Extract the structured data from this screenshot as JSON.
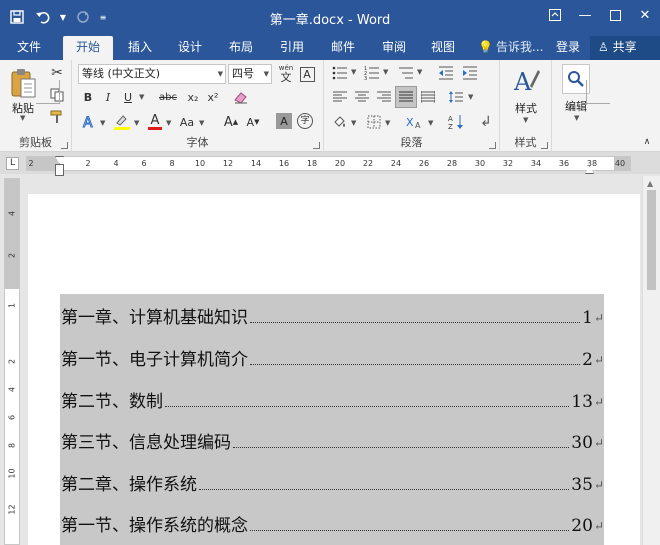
{
  "app": {
    "document_title": "第一章.docx - Word",
    "colors": {
      "brand": "#2b579a",
      "selection": "#c8c8c8"
    }
  },
  "tabs": [
    "文件",
    "开始",
    "插入",
    "设计",
    "布局",
    "引用",
    "邮件",
    "审阅",
    "视图"
  ],
  "active_tab": "开始",
  "tell_me": "告诉我...",
  "sign_in": "登录",
  "share": "共享",
  "ribbon": {
    "clipboard": {
      "label": "剪贴板",
      "paste": "粘贴"
    },
    "font": {
      "label": "字体",
      "font_name": "等线 (中文正文)",
      "font_size": "四号",
      "wen": "wén",
      "wen_char": "文",
      "A_big": "A",
      "bold": "B",
      "italic": "I",
      "underline": "U",
      "strike": "abc",
      "subscript": "x₂",
      "superscript": "x²",
      "aa_up": "A",
      "aa_down": "A",
      "char_shade": "A",
      "enclose": "字"
    },
    "paragraph": {
      "label": "段落"
    },
    "styles": {
      "label": "样式",
      "button": "样式"
    },
    "editing": {
      "button": "编辑"
    }
  },
  "ruler": {
    "numbers": [
      "2",
      "2",
      "4",
      "6",
      "8",
      "10",
      "12",
      "14",
      "16",
      "18",
      "20",
      "22",
      "24",
      "26",
      "28",
      "30",
      "32",
      "34",
      "36",
      "38",
      "40"
    ],
    "vertical_numbers": [
      "4",
      "2",
      "1",
      "2",
      "4",
      "6",
      "8",
      "10",
      "12"
    ]
  },
  "toc": [
    {
      "title": "第一章、计算机基础知识",
      "page": "1"
    },
    {
      "title": "第一节、电子计算机简介",
      "page": "2"
    },
    {
      "title": "第二节、数制",
      "page": "13"
    },
    {
      "title": "第三节、信息处理编码",
      "page": "30"
    },
    {
      "title": "第二章、操作系统",
      "page": "35"
    },
    {
      "title": "第一节、操作系统的概念",
      "page": "20"
    }
  ],
  "paragraph_mark": "↵"
}
